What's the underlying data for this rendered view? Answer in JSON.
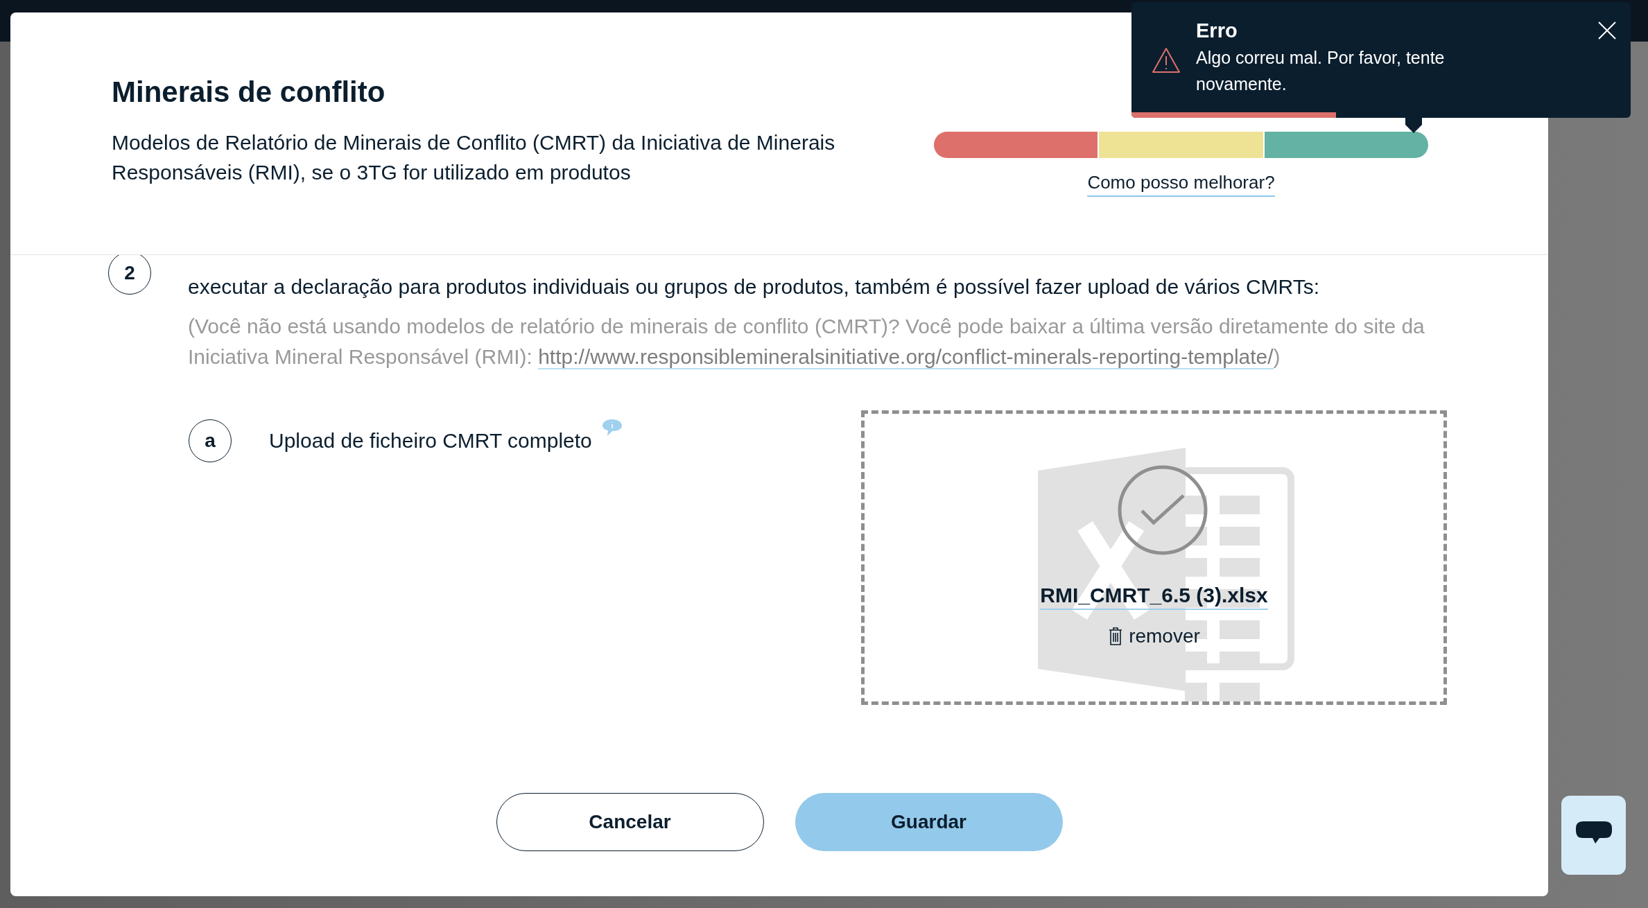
{
  "modal": {
    "title": "Minerais de conflito",
    "description": "Modelos de Relatório de Minerais de Conflito (CMRT) da Iniciativa de Minerais Responsáveis (RMI), se o 3TG for utilizado em produtos"
  },
  "score": {
    "level": 0.97,
    "link": "Como posso melhorar?"
  },
  "step": {
    "number": "2",
    "text": "executar a declaração para produtos individuais ou grupos de produtos, também é possível fazer upload de vários CMRTs:",
    "note": "(Você não está usando modelos de relatório de minerais de conflito (CMRT)? Você pode baixar a última versão diretamente do site da Iniciativa Mineral Responsável (RMI): ",
    "note_link": "http://www.responsiblemineralsinitiative.org/conflict-minerals-reporting-template/",
    "note_end": ")"
  },
  "substep": {
    "letter": "a",
    "label": "Upload de ficheiro CMRT completo"
  },
  "upload": {
    "uploaded": true,
    "file_name": "RMI_CMRT_6.5 (3).xlsx",
    "remove": "remover"
  },
  "buttons": [
    {
      "label": "Cancelar",
      "kind": "secondary"
    },
    {
      "label": "Guardar",
      "kind": "primary"
    }
  ],
  "toast": {
    "title": "Erro",
    "message": "Algo correu mal. Por favor, tente novamente.",
    "level": 0.41
  }
}
